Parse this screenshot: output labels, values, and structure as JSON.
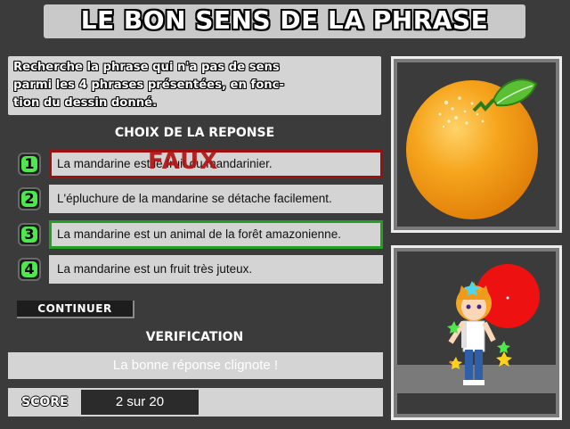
{
  "title": "LE BON SENS DE LA PHRASE",
  "instructions": "Recherche la phrase qui n'a pas de sens parmi les 4 phrases présentées, en fonction du dessin donné.",
  "instructions_lines": [
    "Recherche la phrase qui n'a pas de sens",
    "parmi les 4 phrases présentées, en fonc-",
    "tion du dessin donné."
  ],
  "choice_heading": "CHOIX DE LA REPONSE",
  "answers": [
    {
      "number": "1",
      "text": "La mandarine est le fruit du mandarinier.",
      "state": "wrong",
      "overlay": "FAUX"
    },
    {
      "number": "2",
      "text": "L'épluchure de la mandarine se détache facilement.",
      "state": "normal"
    },
    {
      "number": "3",
      "text": "La mandarine est un animal de la forêt amazonienne.",
      "state": "correct"
    },
    {
      "number": "4",
      "text": "La mandarine est un fruit très juteux.",
      "state": "normal"
    }
  ],
  "continue_label": "CONTINUER",
  "verification_heading": "VERIFICATION",
  "verification_message": "La bonne réponse clignote !",
  "score_label": "SCORE",
  "score_value": "2 sur 20",
  "colors": {
    "background": "#3b3b3b",
    "panel": "#d4d4d4",
    "wrong_border": "#a10e0e",
    "correct_border": "#23a023",
    "number_badge": "#4ee84e",
    "fruit_orange": "#f5a21b",
    "mascot_sun": "#ee1111"
  },
  "images": {
    "top": "mandarin-fruit-illustration",
    "bottom": "cartoon-boy-mascot-with-stars"
  }
}
